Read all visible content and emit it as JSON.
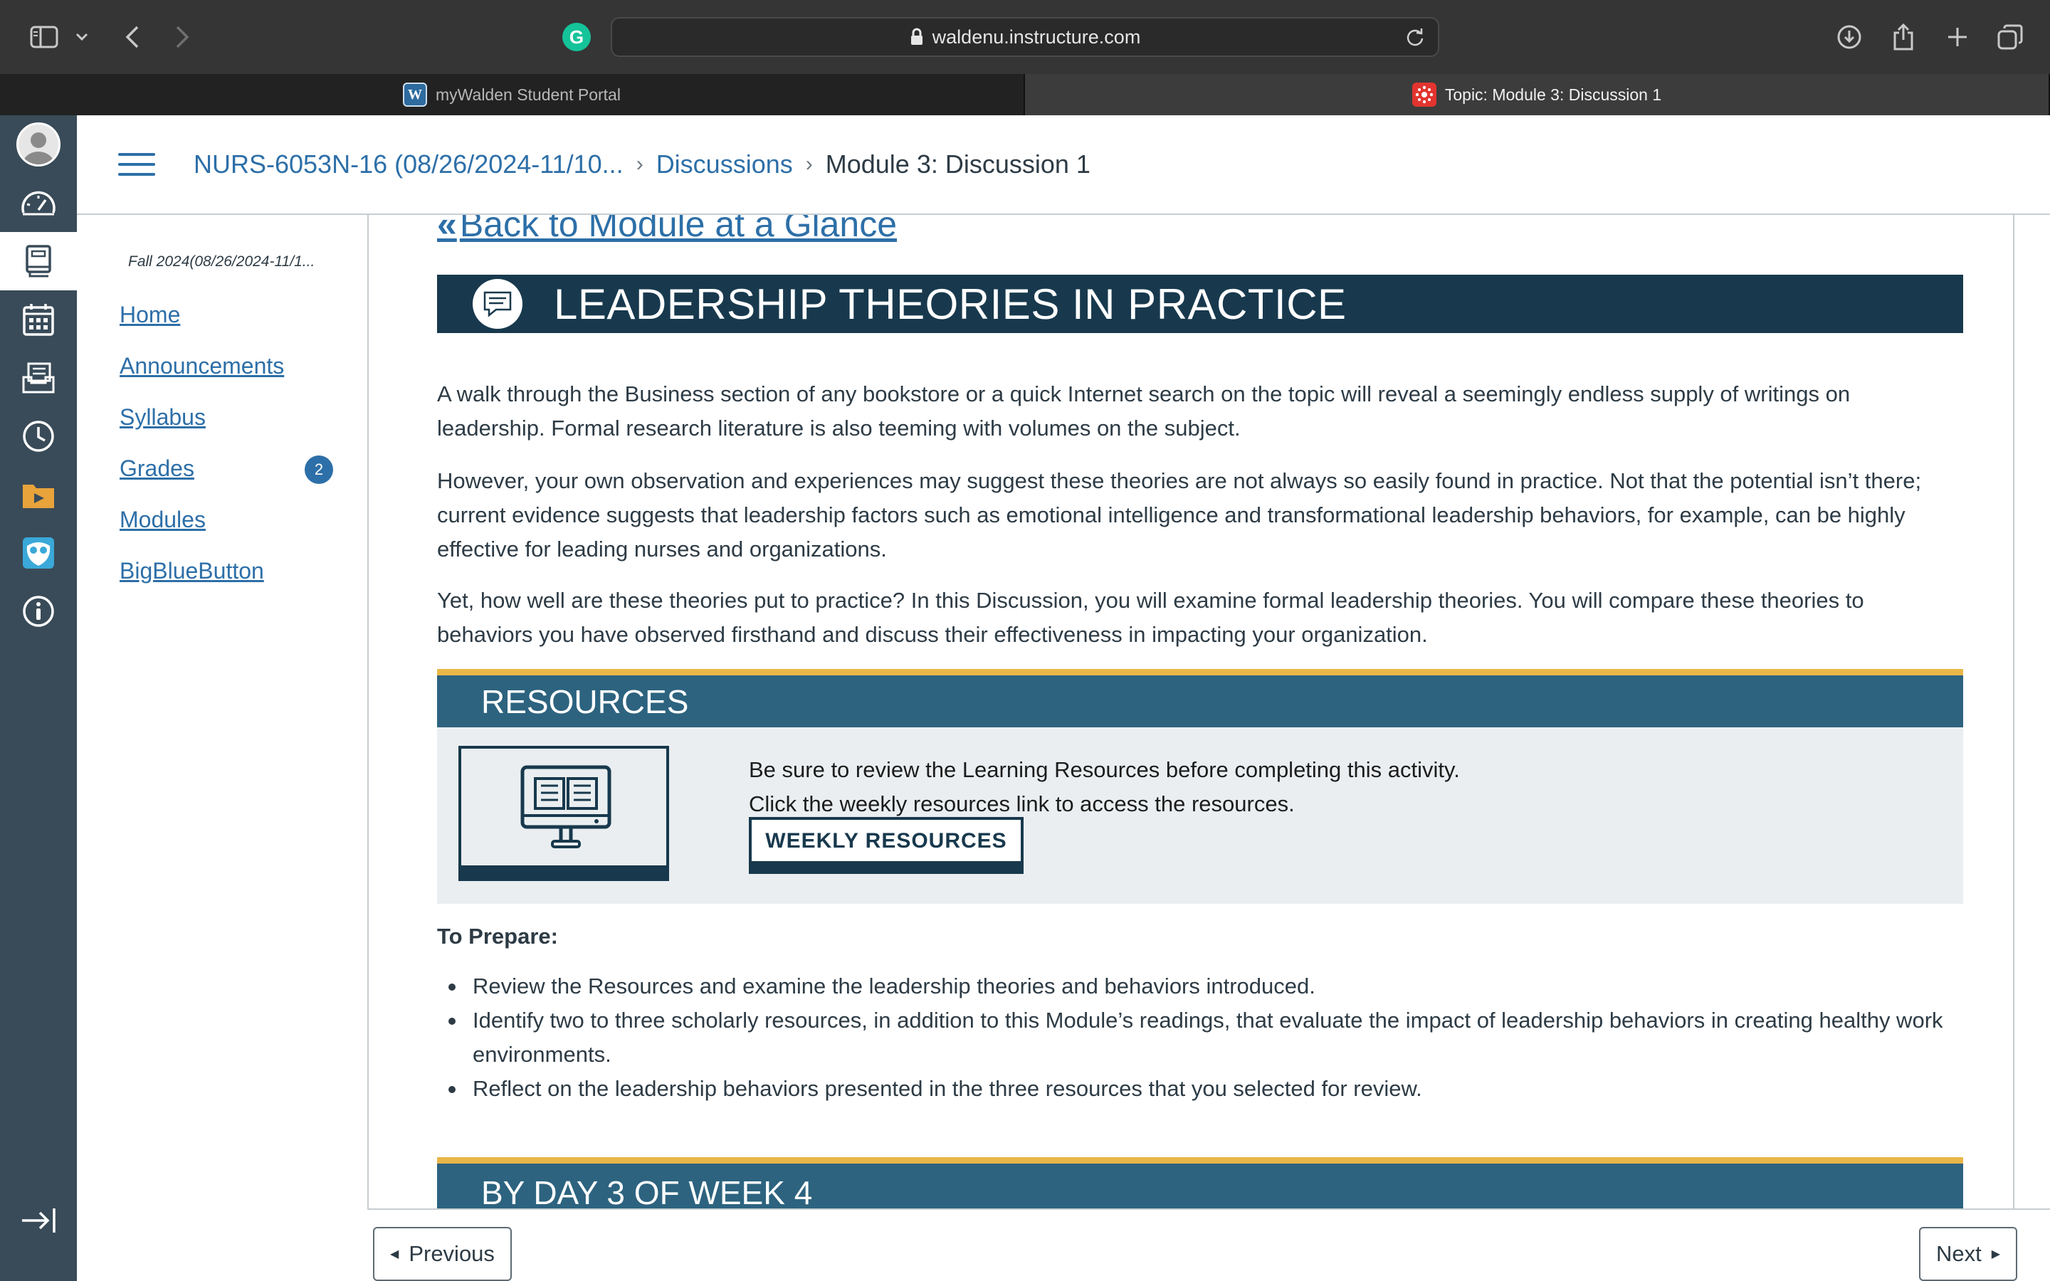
{
  "browser": {
    "url": "waldenu.instructure.com",
    "tabs": [
      {
        "label": "myWalden Student Portal",
        "favicon": "W",
        "active": false
      },
      {
        "label": "Topic: Module 3: Discussion 1",
        "favicon": "canvas-icon",
        "active": true
      }
    ],
    "extension_icon": "G"
  },
  "breadcrumb": {
    "course": "NURS-6053N-16 (08/26/2024-11/10...",
    "section": "Discussions",
    "current": "Module 3: Discussion 1"
  },
  "course_nav": {
    "term": "Fall 2024(08/26/2024-11/1...",
    "items": [
      {
        "label": "Home"
      },
      {
        "label": "Announcements"
      },
      {
        "label": "Syllabus"
      },
      {
        "label": "Grades",
        "badge": "2"
      },
      {
        "label": "Modules"
      },
      {
        "label": "BigBlueButton"
      }
    ]
  },
  "content": {
    "back_link": "Back to Module at a Glance",
    "back_chevron": "«",
    "title": "LEADERSHIP THEORIES IN PRACTICE",
    "paragraphs": [
      "A walk through the Business section of any bookstore or a quick Internet search on the topic will reveal a seemingly endless supply of writings on leadership. Formal research literature is also teeming with volumes on the subject.",
      "However, your own observation and experiences may suggest these theories are not always so easily found in practice. Not that the potential isn’t there; current evidence suggests that leadership factors such as emotional intelligence and transformational leadership behaviors, for example, can be highly effective for leading nurses and organizations.",
      "Yet, how well are these theories put to practice? In this Discussion, you will examine formal leadership theories. You will compare these theories to behaviors you have observed firsthand and discuss their effectiveness in impacting your organization."
    ],
    "resources": {
      "heading": "RESOURCES",
      "line1": "Be sure to review the Learning Resources before completing this activity.",
      "line2": "Click the weekly resources link to access the resources.",
      "button": "WEEKLY RESOURCES"
    },
    "prepare_title": "To Prepare:",
    "prepare_items": [
      "Review the Resources and examine the leadership theories and behaviors introduced.",
      "Identify two to three scholarly resources, in addition to this Module’s readings, that evaluate the impact of leadership behaviors in creating healthy work environments.",
      "Reflect on the leadership behaviors presented in the three resources that you selected for review."
    ],
    "day_heading": "BY DAY 3 OF WEEK 4"
  },
  "footer": {
    "previous": "Previous",
    "next": "Next"
  },
  "colors": {
    "link": "#2d6fa8",
    "banner_dark": "#18394d",
    "banner_teal": "#2d637f",
    "accent_gold": "#e9b649",
    "global_nav": "#394b58"
  }
}
